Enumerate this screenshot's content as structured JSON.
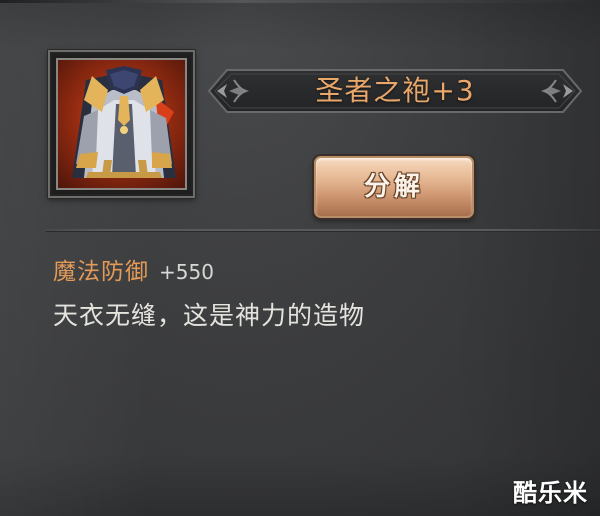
{
  "item": {
    "name": "圣者之袍+3",
    "icon": "robe-armor-icon",
    "rarity_color": "#e9a76a"
  },
  "actions": {
    "decompose_label": "分解"
  },
  "stats": [
    {
      "name": "魔法防御",
      "value": "+550"
    }
  ],
  "description": "天衣无缝，这是神力的造物",
  "watermark": "酷乐米",
  "colors": {
    "stat_name": "#e39a58",
    "description": "#e4e3de",
    "background": "#3c3d3f",
    "icon_background": "#9a2d12"
  }
}
